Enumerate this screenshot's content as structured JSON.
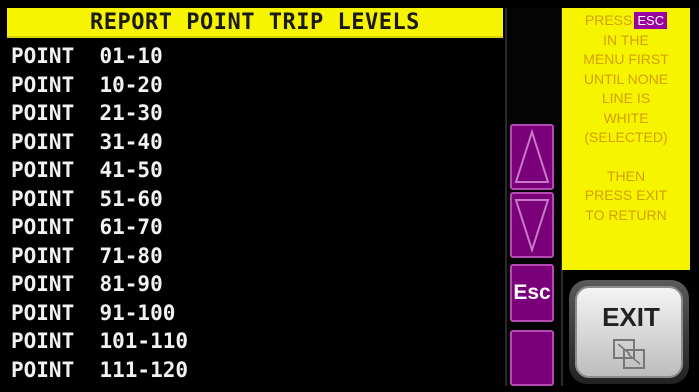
{
  "title": "REPORT POINT TRIP LEVELS",
  "points": [
    "POINT  01-10",
    "POINT  10-20",
    "POINT  21-30",
    "POINT  31-40",
    "POINT  41-50",
    "POINT  51-60",
    "POINT  61-70",
    "POINT  71-80",
    "POINT  81-90",
    "POINT  91-100",
    "POINT  101-110",
    "POINT  111-120"
  ],
  "nav": {
    "up_icon": "triangle-up-icon",
    "down_icon": "triangle-down-icon",
    "esc_label": "Esc"
  },
  "help": {
    "press": "PRESS",
    "esc_badge": "ESC",
    "lines": [
      "IN THE",
      "MENU FIRST",
      "UNTIL NONE",
      "LINE IS",
      "WHITE",
      "(SELECTED)"
    ],
    "then_lines": [
      "THEN",
      "PRESS EXIT",
      "TO RETURN"
    ]
  },
  "exit": {
    "label": "EXIT",
    "icon": "exit-icon"
  },
  "colors": {
    "title_bg": "#f7f400",
    "help_text": "#d4a000",
    "nav_button": "#7a007a"
  }
}
